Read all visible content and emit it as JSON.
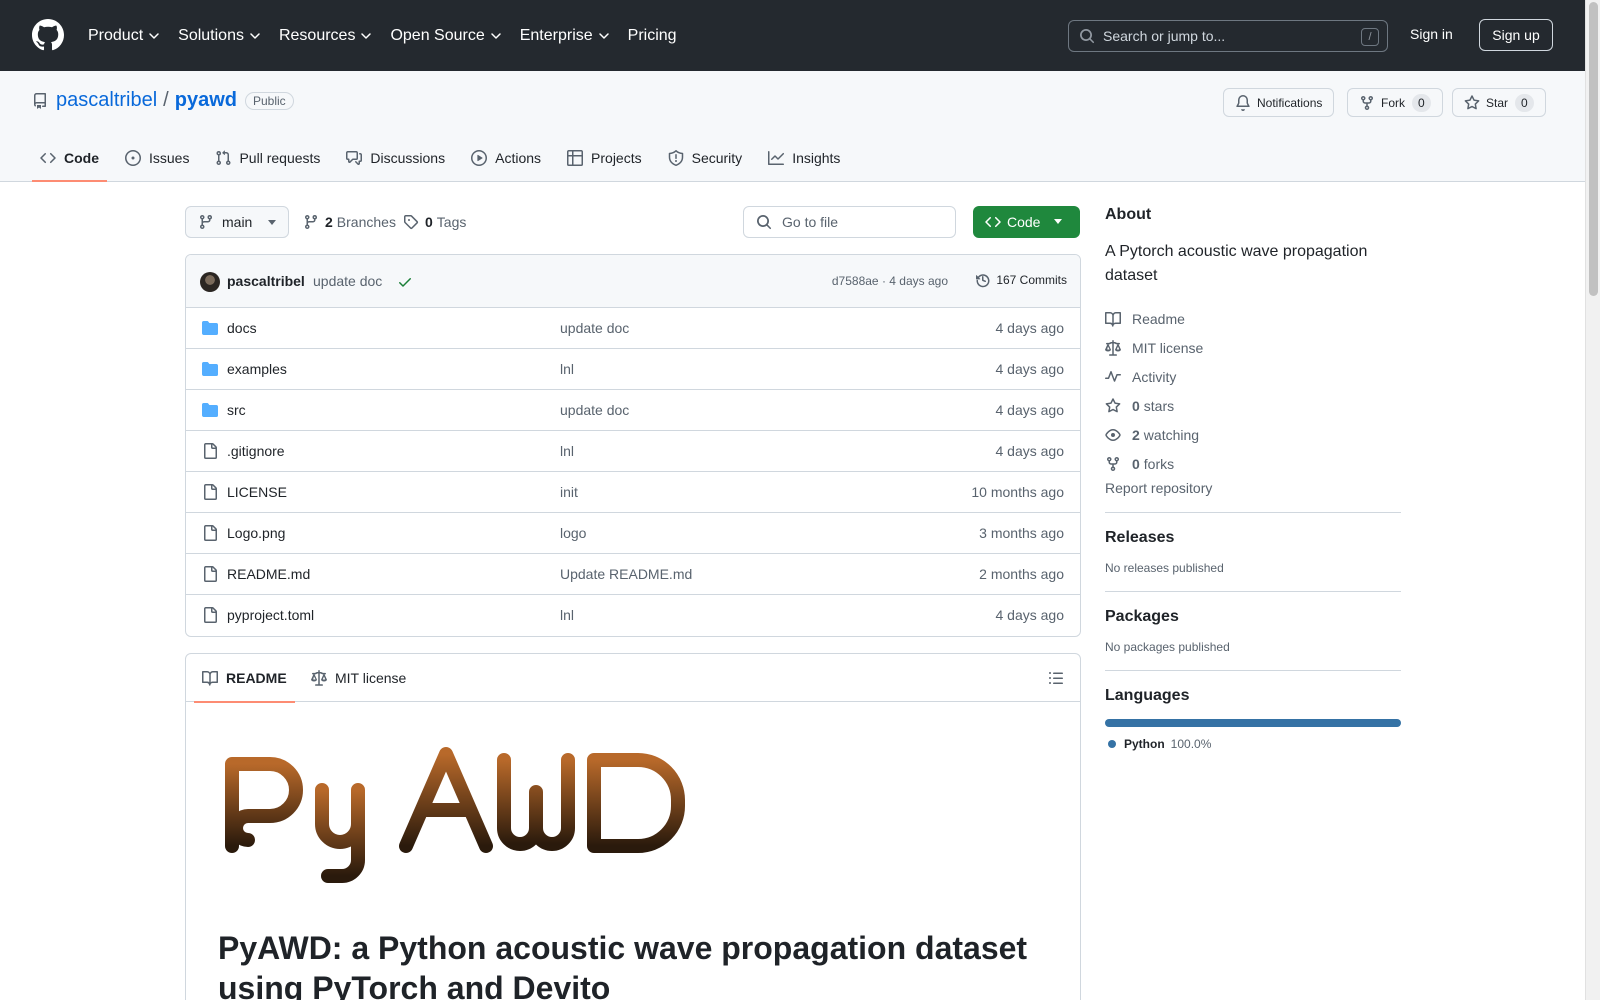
{
  "header": {
    "nav": [
      {
        "label": "Product",
        "has_menu": true
      },
      {
        "label": "Solutions",
        "has_menu": true
      },
      {
        "label": "Resources",
        "has_menu": true
      },
      {
        "label": "Open Source",
        "has_menu": true
      },
      {
        "label": "Enterprise",
        "has_menu": true
      },
      {
        "label": "Pricing",
        "has_menu": false
      }
    ],
    "search_placeholder": "Search or jump to...",
    "search_shortcut": "/",
    "sign_in": "Sign in",
    "sign_up": "Sign up"
  },
  "repo": {
    "owner": "pascaltribel",
    "separator": "/",
    "name": "pyawd",
    "visibility": "Public",
    "notifications_label": "Notifications",
    "fork_label": "Fork",
    "fork_count": "0",
    "star_label": "Star",
    "star_count": "0",
    "tabs": [
      "Code",
      "Issues",
      "Pull requests",
      "Discussions",
      "Actions",
      "Projects",
      "Security",
      "Insights"
    ],
    "active_tab": "Code"
  },
  "toolbar": {
    "branch": "main",
    "branches_count": "2",
    "branches_label": "Branches",
    "tags_count": "0",
    "tags_label": "Tags",
    "go_to_file_placeholder": "Go to file",
    "code_button": "Code"
  },
  "commit": {
    "author": "pascaltribel",
    "message": "update doc",
    "hash": "d7588ae",
    "separator": "·",
    "time": "4 days ago",
    "commits_label": "167 Commits"
  },
  "files": [
    {
      "name": "docs",
      "type": "folder",
      "message": "update doc",
      "date": "4 days ago"
    },
    {
      "name": "examples",
      "type": "folder",
      "message": "lnl",
      "date": "4 days ago"
    },
    {
      "name": "src",
      "type": "folder",
      "message": "update doc",
      "date": "4 days ago"
    },
    {
      "name": ".gitignore",
      "type": "file",
      "message": "lnl",
      "date": "4 days ago"
    },
    {
      "name": "LICENSE",
      "type": "file",
      "message": "init",
      "date": "10 months ago"
    },
    {
      "name": "Logo.png",
      "type": "file",
      "message": "logo",
      "date": "3 months ago"
    },
    {
      "name": "README.md",
      "type": "file",
      "message": "Update README.md",
      "date": "2 months ago"
    },
    {
      "name": "pyproject.toml",
      "type": "file",
      "message": "lnl",
      "date": "4 days ago"
    }
  ],
  "readme": {
    "tabs": [
      "README",
      "MIT license"
    ],
    "logo_text": "PyAWD",
    "heading": "PyAWD: a Python acoustic wave propagation dataset using PyTorch and Devito"
  },
  "sidebar": {
    "about_title": "About",
    "description": "A Pytorch acoustic wave propagation dataset",
    "links": [
      {
        "icon": "book-icon",
        "count": "",
        "label": "Readme"
      },
      {
        "icon": "law-icon",
        "count": "",
        "label": "MIT license"
      },
      {
        "icon": "pulse-icon",
        "count": "",
        "label": "Activity"
      },
      {
        "icon": "star-icon",
        "count": "0",
        "label": "stars"
      },
      {
        "icon": "eye-icon",
        "count": "2",
        "label": "watching"
      },
      {
        "icon": "fork-icon",
        "count": "0",
        "label": "forks"
      }
    ],
    "report": "Report repository",
    "releases_title": "Releases",
    "releases_empty": "No releases published",
    "packages_title": "Packages",
    "packages_empty": "No packages published",
    "languages_title": "Languages",
    "languages": [
      {
        "name": "Python",
        "percent": "100.0%",
        "color": "#3572a5"
      }
    ]
  },
  "colors": {
    "header_bg": "#24292f",
    "primary_button": "#1f883d",
    "link": "#0969da",
    "active_tab_underline": "#fd8c73",
    "folder_icon": "#54aeff",
    "logo_gradient_top": "#b8692a",
    "logo_gradient_bottom": "#2a1a0c"
  }
}
